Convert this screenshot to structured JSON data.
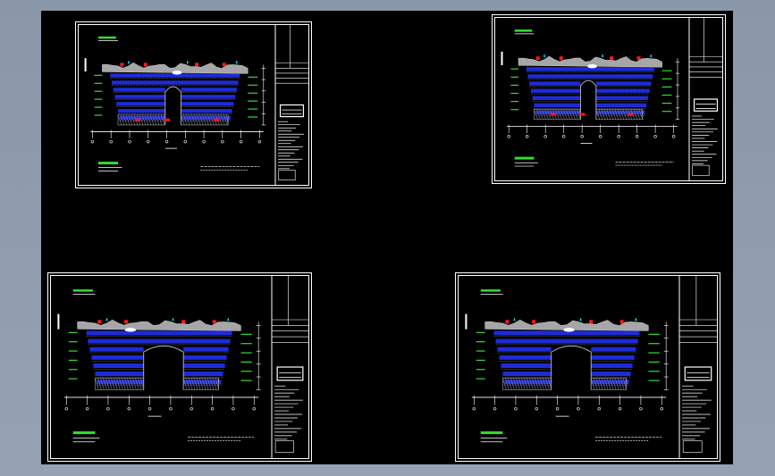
{
  "viewport": {
    "background": "#000000",
    "frame_color": "#8e9bac"
  },
  "drawing_colors": {
    "border": "#ffffff",
    "structure": "#1f2bd6",
    "rock": "#a6a6a6",
    "highlight": "#ff1a1a",
    "annotation": "#33dd33",
    "cyan": "#00e5ff"
  },
  "sheets": [
    {
      "name": "sheet-top-left",
      "variant": "a"
    },
    {
      "name": "sheet-top-right",
      "variant": "b"
    },
    {
      "name": "sheet-bottom-left",
      "variant": "c"
    },
    {
      "name": "sheet-bottom-right",
      "variant": "d"
    }
  ]
}
